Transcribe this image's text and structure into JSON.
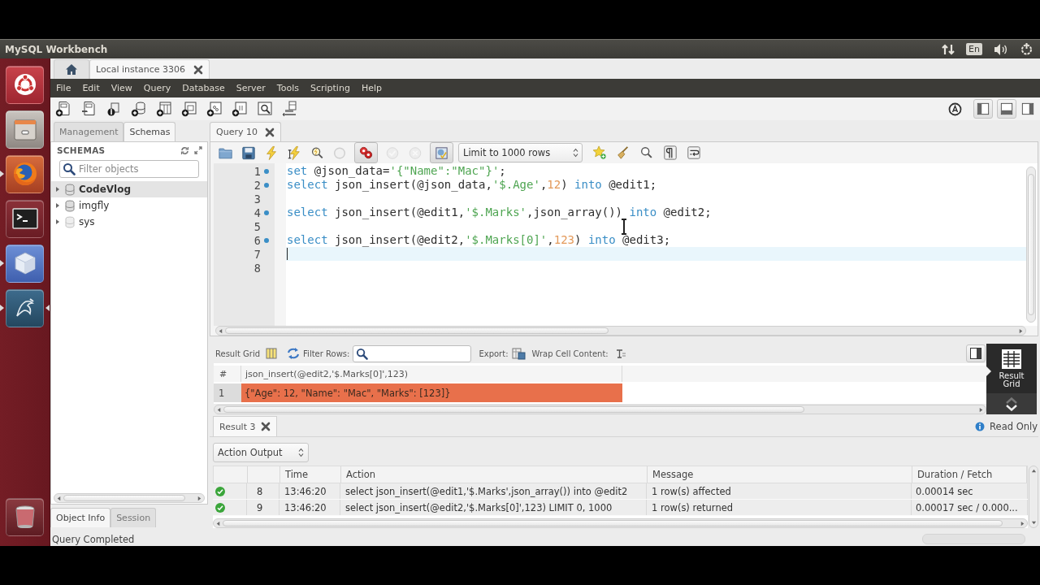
{
  "top_panel": {
    "title": "MySQL Workbench",
    "keyboard_layout": "En"
  },
  "launcher": [
    {
      "kind": "dash",
      "running": false,
      "focused": false
    },
    {
      "kind": "files",
      "running": false,
      "focused": false
    },
    {
      "kind": "browser",
      "running": true,
      "focused": false
    },
    {
      "kind": "terminal",
      "running": false,
      "focused": false
    },
    {
      "kind": "cube",
      "running": true,
      "focused": false
    },
    {
      "kind": "workbench",
      "running": true,
      "focused": true
    },
    {
      "kind": "trash",
      "running": false,
      "focused": false
    }
  ],
  "connection_tabs": [
    {
      "kind": "home",
      "selected": false
    },
    {
      "kind": "connection",
      "label": "Local instance 3306",
      "selected": true
    }
  ],
  "menu": [
    "File",
    "Edit",
    "View",
    "Query",
    "Database",
    "Server",
    "Tools",
    "Scripting",
    "Help"
  ],
  "panel_toggles": [
    {
      "kind": "sidebar",
      "on": true
    },
    {
      "kind": "output",
      "on": true
    },
    {
      "kind": "secondary",
      "on": false
    }
  ],
  "sidebar": {
    "tabs": [
      {
        "label": "Management",
        "selected": false
      },
      {
        "label": "Schemas",
        "selected": true
      }
    ],
    "title": "SCHEMAS",
    "filter": {
      "placeholder": "Filter objects"
    },
    "schemas": [
      {
        "name": "CodeVlog",
        "selected": true,
        "default": true,
        "system": false
      },
      {
        "name": "imgfly",
        "selected": false,
        "default": false,
        "system": false
      },
      {
        "name": "sys",
        "selected": false,
        "default": false,
        "system": true
      }
    ],
    "bottom_tabs": [
      {
        "label": "Object Info",
        "selected": true
      },
      {
        "label": "Session",
        "selected": false
      }
    ]
  },
  "query_tabs": [
    {
      "label": "Query 10",
      "selected": true
    }
  ],
  "editor_toolbar": {
    "buttons": [
      {
        "kind": "open",
        "disabled": false,
        "pressed": false
      },
      {
        "kind": "save",
        "disabled": false,
        "pressed": false
      },
      {
        "kind": "execute",
        "disabled": false,
        "pressed": false
      },
      {
        "kind": "execute_current",
        "disabled": false,
        "pressed": false
      },
      {
        "kind": "explain",
        "disabled": false,
        "pressed": false
      },
      {
        "kind": "stop",
        "disabled": true,
        "pressed": false
      },
      {
        "kind": "stop_on_error",
        "disabled": false,
        "pressed": true
      },
      {
        "kind": "commit",
        "disabled": true,
        "pressed": false
      },
      {
        "kind": "rollback",
        "disabled": true,
        "pressed": false
      },
      {
        "kind": "autocommit",
        "disabled": false,
        "pressed": true
      }
    ],
    "limit": "Limit to 1000 rows",
    "tools": [
      {
        "kind": "snippet"
      },
      {
        "kind": "beautify"
      },
      {
        "kind": "find"
      },
      {
        "kind": "invisibles"
      },
      {
        "kind": "wrap"
      }
    ]
  },
  "editor": {
    "lines": [
      {
        "number": "1",
        "marker": true,
        "current": false,
        "tokens": [
          {
            "kind": "keyword",
            "text": "set"
          },
          {
            "kind": "plain",
            "text": " @json_data="
          },
          {
            "kind": "string",
            "text": "'{\"Name\":\"Mac\"}'"
          },
          {
            "kind": "plain",
            "text": ";"
          }
        ]
      },
      {
        "number": "2",
        "marker": true,
        "current": false,
        "tokens": [
          {
            "kind": "keyword",
            "text": "select"
          },
          {
            "kind": "plain",
            "text": " json_insert(@json_data,"
          },
          {
            "kind": "string",
            "text": "'$.Age'"
          },
          {
            "kind": "plain",
            "text": ","
          },
          {
            "kind": "number",
            "text": "12"
          },
          {
            "kind": "plain",
            "text": ") "
          },
          {
            "kind": "keyword",
            "text": "into"
          },
          {
            "kind": "plain",
            "text": " @edit1;"
          }
        ]
      },
      {
        "number": "3",
        "marker": false,
        "current": false
      },
      {
        "number": "4",
        "marker": true,
        "current": false,
        "tokens": [
          {
            "kind": "keyword",
            "text": "select"
          },
          {
            "kind": "plain",
            "text": " json_insert(@edit1,"
          },
          {
            "kind": "string",
            "text": "'$.Marks'"
          },
          {
            "kind": "plain",
            "text": ",json_array()) "
          },
          {
            "kind": "keyword",
            "text": "into"
          },
          {
            "kind": "plain",
            "text": " @edit2;"
          }
        ]
      },
      {
        "number": "5",
        "marker": false,
        "current": false
      },
      {
        "number": "6",
        "marker": true,
        "current": false,
        "tokens": [
          {
            "kind": "keyword",
            "text": "select"
          },
          {
            "kind": "plain",
            "text": " json_insert(@edit2,"
          },
          {
            "kind": "string",
            "text": "'$.Marks[0]'"
          },
          {
            "kind": "plain",
            "text": ","
          },
          {
            "kind": "number",
            "text": "123"
          },
          {
            "kind": "plain",
            "text": ") "
          },
          {
            "kind": "keyword",
            "text": "into"
          },
          {
            "kind": "plain",
            "text": " @edit3;"
          }
        ]
      },
      {
        "number": "7",
        "marker": false,
        "current": true
      },
      {
        "number": "8",
        "marker": false,
        "current": false
      }
    ]
  },
  "result_toolbar": {
    "view_label": "Result Grid",
    "filter_label": "Filter Rows:",
    "export_label": "Export:",
    "wrap_label": "Wrap Cell Content:"
  },
  "result_grid": {
    "columns": [
      "#",
      "json_insert(@edit2,'$.Marks[0]',123)"
    ],
    "rows": [
      {
        "number": "1",
        "value": "{\"Age\": 12, \"Name\": \"Mac\", \"Marks\": [123]}",
        "selected": true
      }
    ]
  },
  "result_side": {
    "label": "Result Grid"
  },
  "result_tabs": [
    {
      "label": "Result 3",
      "selected": true
    }
  ],
  "read_only": "Read Only",
  "output": {
    "selector": "Action Output",
    "columns": [
      "Time",
      "Action",
      "Message",
      "Duration / Fetch"
    ],
    "rows": [
      {
        "kind": "success",
        "number": "8",
        "time": "13:46:20",
        "action": "select json_insert(@edit1,'$.Marks',json_array()) into @edit2",
        "message": "1 row(s) affected",
        "duration": "0.00014 sec"
      },
      {
        "kind": "success",
        "number": "9",
        "time": "13:46:20",
        "action": "select json_insert(@edit2,'$.Marks[0]',123) LIMIT 0, 1000",
        "message": "1 row(s) returned",
        "duration": "0.00017 sec / 0.000..."
      }
    ]
  },
  "status_bar": {
    "text": "Query Completed"
  }
}
